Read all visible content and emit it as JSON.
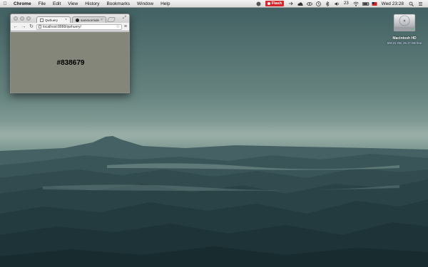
{
  "desktop": {
    "wallpaper_sky": "#6e8a86",
    "wallpaper_mountains": "#2a4448"
  },
  "menubar": {
    "apple_icon": "apple-icon",
    "app_name": "Chrome",
    "items": [
      "File",
      "Edit",
      "View",
      "History",
      "Bookmarks",
      "Window",
      "Help"
    ],
    "flash_label": "Flash",
    "flash_color": "#d8262c",
    "volume_text": "23",
    "clock": "Wed 23:28"
  },
  "disk": {
    "name": "Macintosh HD",
    "info": "500.21 GB, 45.17 GB free"
  },
  "browser": {
    "tabs": [
      {
        "label": "Qwhuery",
        "icon": "page-icon",
        "active": true
      },
      {
        "label": "sammorrisdesign",
        "icon": "github-icon",
        "active": false
      }
    ],
    "url": "localhost:8888/qwhuery/",
    "content": {
      "text": "#838679",
      "background": "#838679"
    }
  }
}
